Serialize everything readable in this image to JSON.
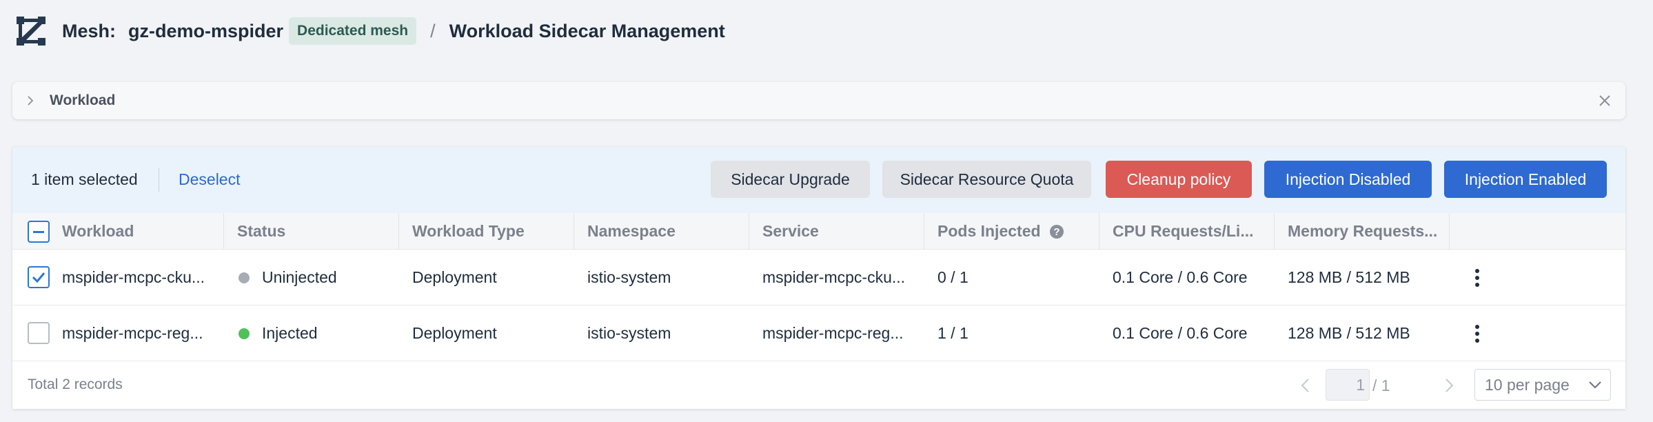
{
  "header": {
    "mesh_label": "Mesh:",
    "mesh_name": "gz-demo-mspider",
    "mesh_badge": "Dedicated mesh",
    "separator": "/",
    "page_title": "Workload Sidecar Management"
  },
  "filter": {
    "label": "Workload"
  },
  "actions": {
    "selected_text": "1 item selected",
    "deselect_label": "Deselect",
    "buttons": {
      "sidecar_upgrade": "Sidecar Upgrade",
      "sidecar_resource_quota": "Sidecar Resource Quota",
      "cleanup_policy": "Cleanup policy",
      "injection_disabled": "Injection Disabled",
      "injection_enabled": "Injection Enabled"
    }
  },
  "table": {
    "columns": {
      "workload": "Workload",
      "status": "Status",
      "workload_type": "Workload Type",
      "namespace": "Namespace",
      "service": "Service",
      "pods_injected": "Pods Injected",
      "cpu": "CPU Requests/Li...",
      "memory": "Memory Requests..."
    },
    "rows": [
      {
        "workload": "mspider-mcpc-cku...",
        "status": "Uninjected",
        "status_color": "#a7acb4",
        "workload_type": "Deployment",
        "namespace": "istio-system",
        "service": "mspider-mcpc-cku...",
        "pods_injected": "0 / 1",
        "cpu": "0.1 Core / 0.6 Core",
        "memory": "128 MB / 512 MB",
        "checked": true
      },
      {
        "workload": "mspider-mcpc-reg...",
        "status": "Injected",
        "status_color": "#4fc05a",
        "workload_type": "Deployment",
        "namespace": "istio-system",
        "service": "mspider-mcpc-reg...",
        "pods_injected": "1 / 1",
        "cpu": "0.1 Core / 0.6 Core",
        "memory": "128 MB / 512 MB",
        "checked": false
      }
    ]
  },
  "footer": {
    "total": "Total 2 records",
    "current_page": "1",
    "page_total": "/ 1",
    "per_page": "10 per page"
  },
  "colors": {
    "primary": "#2e6ad1",
    "danger": "#dc5a55",
    "link": "#2b6acb"
  }
}
